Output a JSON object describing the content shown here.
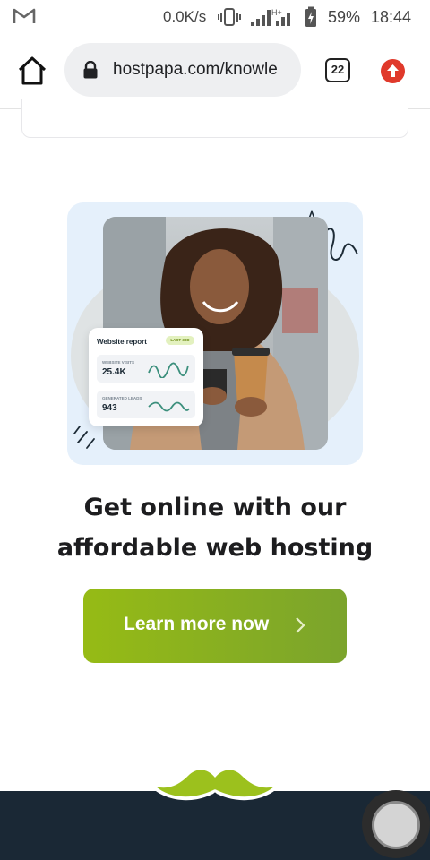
{
  "status_bar": {
    "net_speed": "0.0K/s",
    "network": "H+",
    "battery_percent": "59%",
    "time": "18:44",
    "icons": [
      "gmail-icon",
      "vibrate-icon",
      "signal-icon",
      "battery-icon"
    ]
  },
  "browser": {
    "url": "hostpapa.com/knowle",
    "tab_count": "22",
    "icons": [
      "home-icon",
      "lock-icon",
      "tabs-icon",
      "update-icon"
    ]
  },
  "hero_card": {
    "report_title": "Website report",
    "report_badge": "LAST 30D",
    "stats": [
      {
        "label": "WEBSITE VISITS",
        "value": "25.4K"
      },
      {
        "label": "GENERATED LEADS",
        "value": "943"
      }
    ]
  },
  "promo": {
    "headline_line1": "Get online with our",
    "headline_line2": "affordable web hosting",
    "cta_label": "Learn more now"
  },
  "colors": {
    "accent_green": "#8cb31f",
    "footer_navy": "#1a2835",
    "hero_bg": "#e5f0fb",
    "update_red": "#e0392b"
  }
}
